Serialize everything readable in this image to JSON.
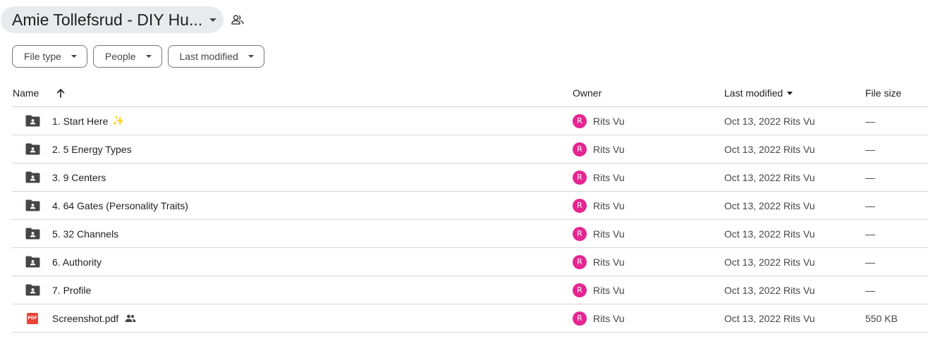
{
  "header": {
    "folder_title": "Amie Tollefsrud - DIY Hu...",
    "title_icon": "shared-people-icon"
  },
  "filters": [
    {
      "label": "File type"
    },
    {
      "label": "People"
    },
    {
      "label": "Last modified"
    }
  ],
  "columns": {
    "name": "Name",
    "owner": "Owner",
    "last_modified": "Last modified",
    "file_size": "File size",
    "sort_direction": "ascending"
  },
  "files": [
    {
      "name": "1. Start Here",
      "emoji": "✨",
      "type": "shared-folder",
      "owner": "Rits Vu",
      "owner_initial": "R",
      "modified": "Oct 13, 2022 Rits Vu",
      "size": "—"
    },
    {
      "name": "2. 5 Energy Types",
      "type": "shared-folder",
      "owner": "Rits Vu",
      "owner_initial": "R",
      "modified": "Oct 13, 2022 Rits Vu",
      "size": "—"
    },
    {
      "name": "3. 9 Centers",
      "type": "shared-folder",
      "owner": "Rits Vu",
      "owner_initial": "R",
      "modified": "Oct 13, 2022 Rits Vu",
      "size": "—"
    },
    {
      "name": "4. 64 Gates (Personality Traits)",
      "type": "shared-folder",
      "owner": "Rits Vu",
      "owner_initial": "R",
      "modified": "Oct 13, 2022 Rits Vu",
      "size": "—"
    },
    {
      "name": "5. 32 Channels",
      "type": "shared-folder",
      "owner": "Rits Vu",
      "owner_initial": "R",
      "modified": "Oct 13, 2022 Rits Vu",
      "size": "—"
    },
    {
      "name": "6. Authority",
      "type": "shared-folder",
      "owner": "Rits Vu",
      "owner_initial": "R",
      "modified": "Oct 13, 2022 Rits Vu",
      "size": "—"
    },
    {
      "name": "7. Profile",
      "type": "shared-folder",
      "owner": "Rits Vu",
      "owner_initial": "R",
      "modified": "Oct 13, 2022 Rits Vu",
      "size": "—"
    },
    {
      "name": "Screenshot.pdf",
      "type": "pdf",
      "badge": "PDF",
      "shared": true,
      "owner": "Rits Vu",
      "owner_initial": "R",
      "modified": "Oct 13, 2022 Rits Vu",
      "size": "550 KB"
    }
  ],
  "colors": {
    "avatar": "#e52592",
    "pdf": "#ea4335",
    "folder": "#444746",
    "title_chip_bg": "#e9eaee"
  }
}
